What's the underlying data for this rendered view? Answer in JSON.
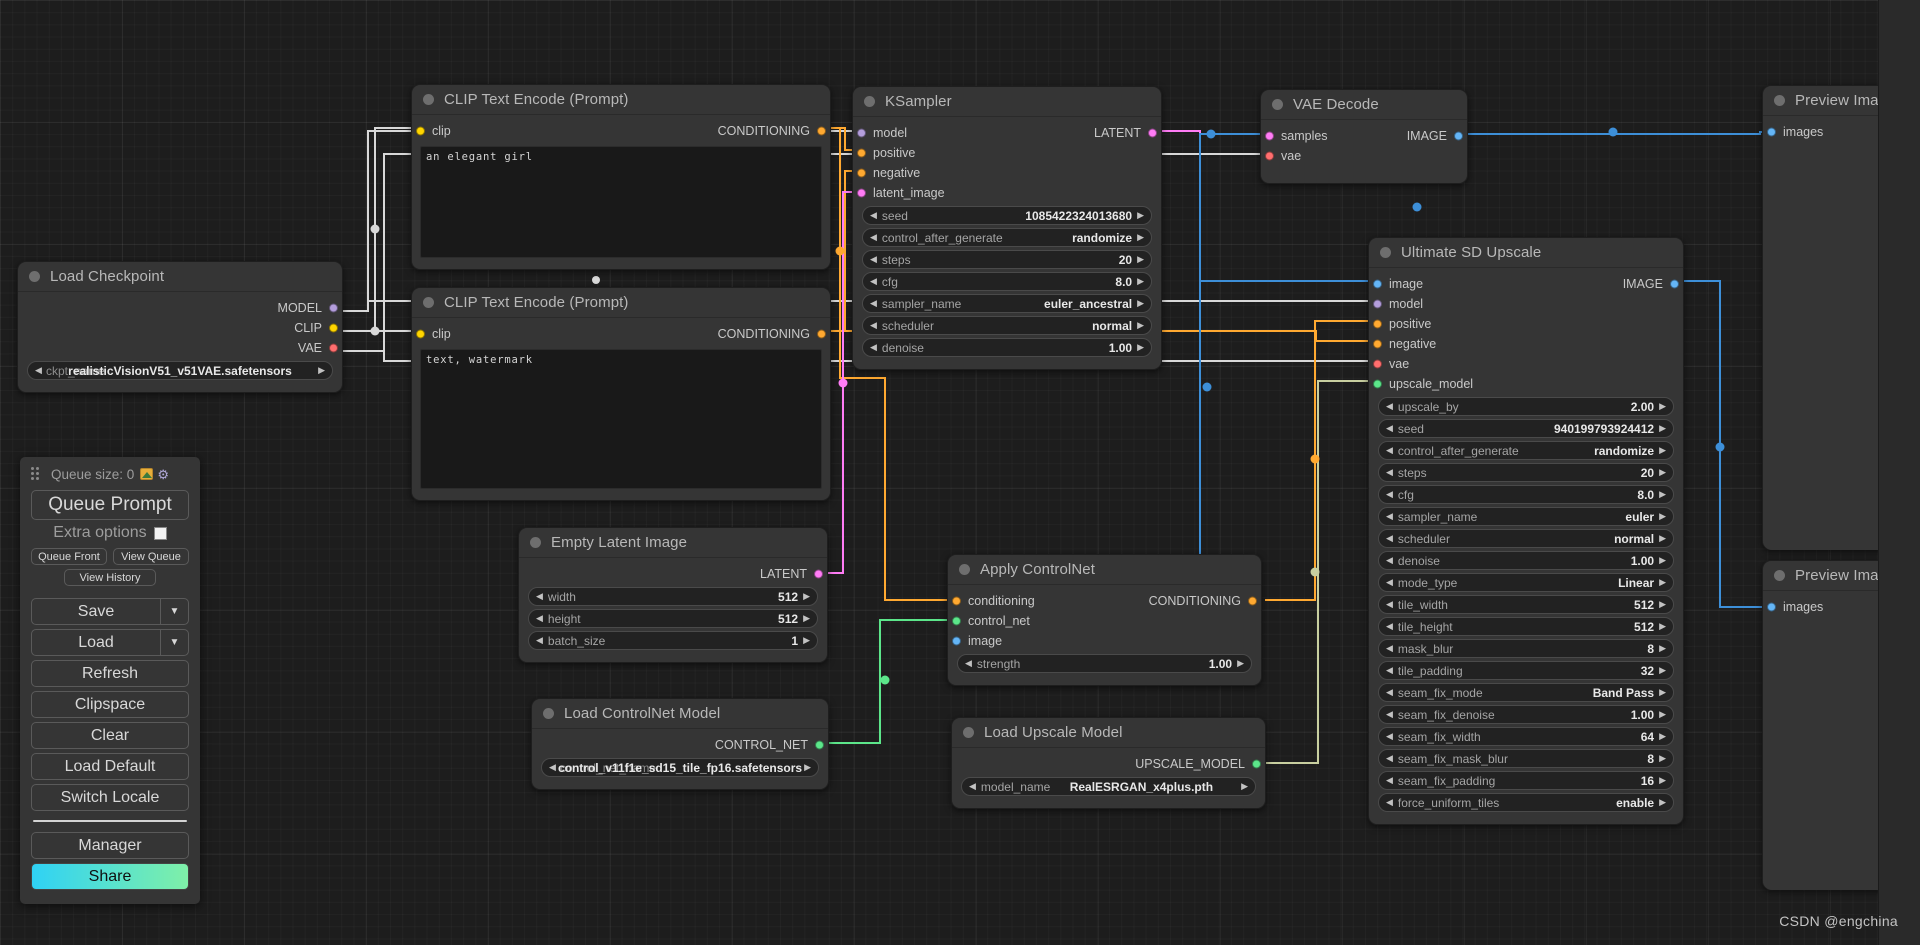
{
  "app": {
    "watermark": "CSDN @engchina"
  },
  "menu": {
    "queue_size_label": "Queue size: 0",
    "image_icon": "image-icon",
    "gear_icon": "gear-icon",
    "queue_prompt": "Queue Prompt",
    "extra_options": "Extra options",
    "queue_front": "Queue Front",
    "view_queue": "View Queue",
    "view_history": "View History",
    "save": "Save",
    "load": "Load",
    "refresh": "Refresh",
    "clipspace": "Clipspace",
    "clear": "Clear",
    "load_default": "Load Default",
    "switch_locale": "Switch Locale",
    "manager": "Manager",
    "share": "Share",
    "caret": "▼"
  },
  "arrows": {
    "left": "◀",
    "right": "▶"
  },
  "nodes": {
    "load_checkpoint": {
      "title": "Load Checkpoint",
      "outputs": [
        {
          "label": "MODEL",
          "color": "#b39ddb"
        },
        {
          "label": "CLIP",
          "color": "#ffd500"
        },
        {
          "label": "VAE",
          "color": "#ff6e6e"
        }
      ],
      "widgets": [
        {
          "label": "ckpt_name",
          "value": "realisticVisionV51_v51VAE.safetensors",
          "type": "combo"
        }
      ]
    },
    "clip_positive": {
      "title": "CLIP Text Encode (Prompt)",
      "input": {
        "label": "clip",
        "color": "#ffd500"
      },
      "output": {
        "label": "CONDITIONING",
        "color": "#ffa931"
      },
      "text": "an elegant girl"
    },
    "clip_negative": {
      "title": "CLIP Text Encode (Prompt)",
      "input": {
        "label": "clip",
        "color": "#ffd500"
      },
      "output": {
        "label": "CONDITIONING",
        "color": "#ffa931"
      },
      "text": "text, watermark"
    },
    "ksampler": {
      "title": "KSampler",
      "inputs": [
        {
          "label": "model",
          "color": "#b39ddb"
        },
        {
          "label": "positive",
          "color": "#ffa931"
        },
        {
          "label": "negative",
          "color": "#ffa931"
        },
        {
          "label": "latent_image",
          "color": "#ff7cf5"
        }
      ],
      "outputs": [
        {
          "label": "LATENT",
          "color": "#ff7cf5"
        }
      ],
      "widgets": [
        {
          "label": "seed",
          "value": "1085422324013680"
        },
        {
          "label": "control_after_generate",
          "value": "randomize"
        },
        {
          "label": "steps",
          "value": "20"
        },
        {
          "label": "cfg",
          "value": "8.0"
        },
        {
          "label": "sampler_name",
          "value": "euler_ancestral"
        },
        {
          "label": "scheduler",
          "value": "normal"
        },
        {
          "label": "denoise",
          "value": "1.00"
        }
      ]
    },
    "vae_decode": {
      "title": "VAE Decode",
      "inputs": [
        {
          "label": "samples",
          "color": "#ff7cf5"
        },
        {
          "label": "vae",
          "color": "#ff6e6e"
        }
      ],
      "outputs": [
        {
          "label": "IMAGE",
          "color": "#64b5f6"
        }
      ]
    },
    "preview_image_top": {
      "title": "Preview Image",
      "inputs": [
        {
          "label": "images",
          "color": "#64b5f6"
        }
      ]
    },
    "preview_image_bottom": {
      "title": "Preview Image",
      "inputs": [
        {
          "label": "images",
          "color": "#64b5f6"
        }
      ]
    },
    "ultimate_sd_upscale": {
      "title": "Ultimate SD Upscale",
      "inputs": [
        {
          "label": "image",
          "color": "#64b5f6"
        },
        {
          "label": "model",
          "color": "#b39ddb"
        },
        {
          "label": "positive",
          "color": "#ffa931"
        },
        {
          "label": "negative",
          "color": "#ffa931"
        },
        {
          "label": "vae",
          "color": "#ff6e6e"
        },
        {
          "label": "upscale_model",
          "color": "#5ce68a"
        }
      ],
      "outputs": [
        {
          "label": "IMAGE",
          "color": "#64b5f6"
        }
      ],
      "widgets": [
        {
          "label": "upscale_by",
          "value": "2.00"
        },
        {
          "label": "seed",
          "value": "940199793924412"
        },
        {
          "label": "control_after_generate",
          "value": "randomize"
        },
        {
          "label": "steps",
          "value": "20"
        },
        {
          "label": "cfg",
          "value": "8.0"
        },
        {
          "label": "sampler_name",
          "value": "euler"
        },
        {
          "label": "scheduler",
          "value": "normal"
        },
        {
          "label": "denoise",
          "value": "1.00"
        },
        {
          "label": "mode_type",
          "value": "Linear"
        },
        {
          "label": "tile_width",
          "value": "512"
        },
        {
          "label": "tile_height",
          "value": "512"
        },
        {
          "label": "mask_blur",
          "value": "8"
        },
        {
          "label": "tile_padding",
          "value": "32"
        },
        {
          "label": "seam_fix_mode",
          "value": "Band Pass"
        },
        {
          "label": "seam_fix_denoise",
          "value": "1.00"
        },
        {
          "label": "seam_fix_width",
          "value": "64"
        },
        {
          "label": "seam_fix_mask_blur",
          "value": "8"
        },
        {
          "label": "seam_fix_padding",
          "value": "16"
        },
        {
          "label": "force_uniform_tiles",
          "value": "enable"
        }
      ]
    },
    "empty_latent": {
      "title": "Empty Latent Image",
      "outputs": [
        {
          "label": "LATENT",
          "color": "#ff7cf5"
        }
      ],
      "widgets": [
        {
          "label": "width",
          "value": "512"
        },
        {
          "label": "height",
          "value": "512"
        },
        {
          "label": "batch_size",
          "value": "1"
        }
      ]
    },
    "apply_controlnet": {
      "title": "Apply ControlNet",
      "inputs": [
        {
          "label": "conditioning",
          "color": "#ffa931"
        },
        {
          "label": "control_net",
          "color": "#5ce68a"
        },
        {
          "label": "image",
          "color": "#64b5f6"
        }
      ],
      "outputs": [
        {
          "label": "CONDITIONING",
          "color": "#ffa931"
        }
      ],
      "widgets": [
        {
          "label": "strength",
          "value": "1.00"
        }
      ]
    },
    "load_controlnet": {
      "title": "Load ControlNet Model",
      "outputs": [
        {
          "label": "CONTROL_NET",
          "color": "#5ce68a"
        }
      ],
      "widgets": [
        {
          "label": "control_net_name",
          "value": "control_v11f1e_sd15_tile_fp16.safetensors",
          "type": "combo"
        }
      ]
    },
    "load_upscale_model": {
      "title": "Load Upscale Model",
      "outputs": [
        {
          "label": "UPSCALE_MODEL",
          "color": "#5ce68a"
        }
      ],
      "widgets": [
        {
          "label": "model_name",
          "value": "RealESRGAN_x4plus.pth"
        }
      ]
    }
  }
}
